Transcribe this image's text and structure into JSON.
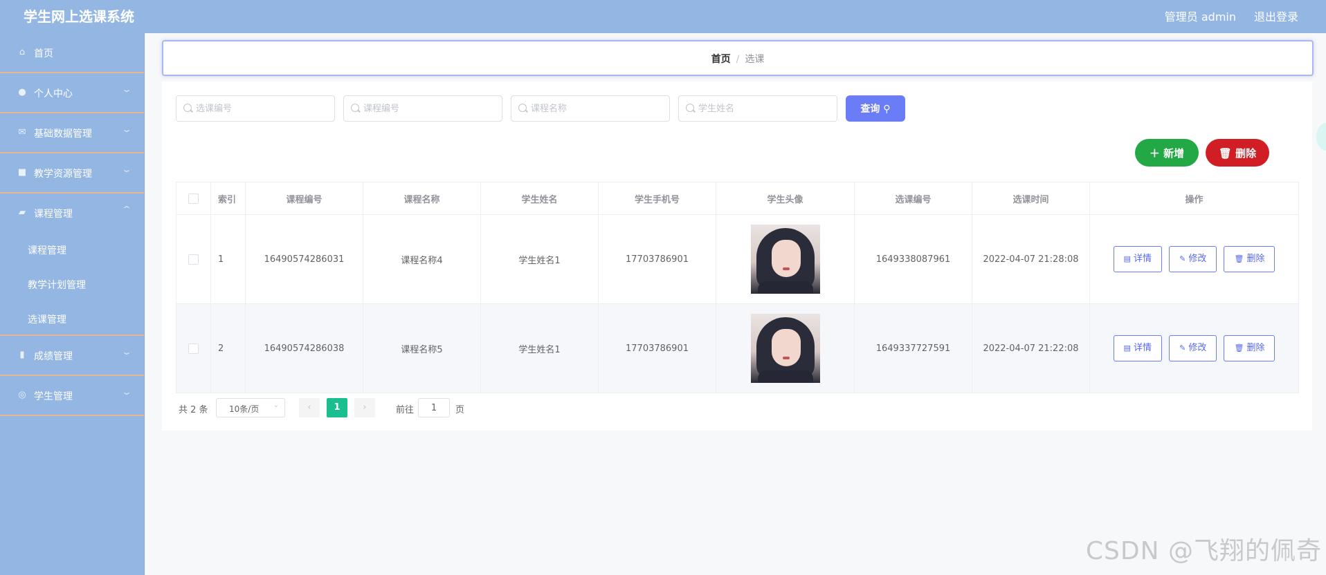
{
  "header": {
    "title": "学生网上选课系统",
    "user": "管理员 admin",
    "logout": "退出登录"
  },
  "sidebar": {
    "items": [
      {
        "label": "首页",
        "icon": "home-icon"
      },
      {
        "label": "个人中心",
        "icon": "user-icon"
      },
      {
        "label": "基础数据管理",
        "icon": "mail-icon"
      },
      {
        "label": "教学资源管理",
        "icon": "briefcase-icon"
      },
      {
        "label": "课程管理",
        "icon": "wallet-icon"
      },
      {
        "label": "成绩管理",
        "icon": "microphone-icon"
      },
      {
        "label": "学生管理",
        "icon": "lifebuoy-icon"
      }
    ],
    "sub_items": [
      "课程管理",
      "教学计划管理",
      "选课管理"
    ]
  },
  "breadcrumb": {
    "home": "首页",
    "separator": "/",
    "current": "选课"
  },
  "search": {
    "p1": "选课编号",
    "p2": "课程编号",
    "p3": "课程名称",
    "p4": "学生姓名",
    "button": "查询"
  },
  "actions": {
    "add": "新增",
    "delete": "删除"
  },
  "table": {
    "headers": [
      "索引",
      "课程编号",
      "课程名称",
      "学生姓名",
      "学生手机号",
      "学生头像",
      "选课编号",
      "选课时间",
      "操作"
    ],
    "rows": [
      {
        "index": "1",
        "course_no": "16490574286031",
        "course_name": "课程名称4",
        "student": "学生姓名1",
        "phone": "17703786901",
        "select_no": "1649338087961",
        "time": "2022-04-07 21:28:08"
      },
      {
        "index": "2",
        "course_no": "16490574286038",
        "course_name": "课程名称5",
        "student": "学生姓名1",
        "phone": "17703786901",
        "select_no": "1649337727591",
        "time": "2022-04-07 21:22:08"
      }
    ],
    "ops": {
      "detail": "详情",
      "edit": "修改",
      "delete": "删除"
    }
  },
  "pager": {
    "total": "共 2 条",
    "page_size": "10条/页",
    "current": "1",
    "goto": "前往",
    "goto_value": "1",
    "page_unit": "页"
  },
  "watermark": "CSDN @飞翔的佩奇",
  "colors": {
    "header_bg": "#94b6e2",
    "accent": "#6b7cf7",
    "add": "#22a845",
    "delete": "#d11e24",
    "pager_current": "#1bbf8f"
  }
}
